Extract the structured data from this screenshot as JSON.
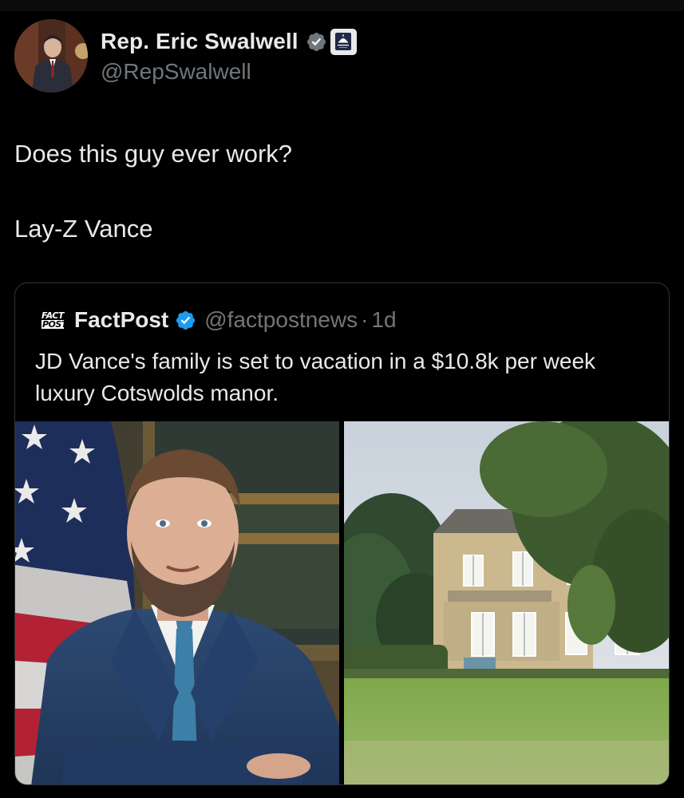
{
  "post": {
    "author_name": "Rep. Eric Swalwell",
    "author_handle": "@RepSwalwell",
    "text_line_1": "Does this guy ever work?",
    "text_line_2": "Lay-Z Vance"
  },
  "quoted_post": {
    "logo_top": "FACT",
    "logo_bottom": "POST",
    "author_name": "FactPost",
    "author_handle": "@factpostnews",
    "separator": "·",
    "time": "1d",
    "text": "JD Vance's family is set to vacation in a $10.8k per week luxury Cotswolds manor."
  },
  "icons": {
    "verified": "verified-badge-icon",
    "government": "capitol-government-badge-icon"
  },
  "colors": {
    "background": "#000000",
    "text_primary": "#e7e9ea",
    "text_secondary": "#71767b",
    "verified_blue": "#1d9bf0",
    "border": "#2f3336"
  }
}
